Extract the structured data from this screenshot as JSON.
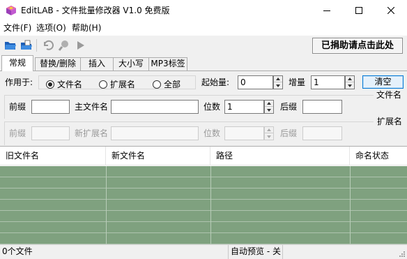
{
  "window": {
    "title": "EditLAB - 文件批量修改器 V1.0 免费版",
    "icon": "app-box-icon"
  },
  "menu": [
    {
      "label": "文件(F)"
    },
    {
      "label": "选项(O)"
    },
    {
      "label": "帮助(H)"
    }
  ],
  "toolbar": {
    "icons": [
      "open-folder-icon",
      "open-files-icon",
      "undo-icon",
      "search-icon",
      "play-icon"
    ],
    "donate_label": "已捐助请点击此处"
  },
  "tabs": [
    {
      "label": "常规",
      "active": true
    },
    {
      "label": "替换/删除"
    },
    {
      "label": "插入"
    },
    {
      "label": "大小写"
    },
    {
      "label": "MP3标签"
    }
  ],
  "general": {
    "apply_to_label": "作用于:",
    "options": [
      {
        "label": "文件名",
        "selected": true
      },
      {
        "label": "扩展名",
        "selected": false
      },
      {
        "label": "全部",
        "selected": false
      }
    ],
    "start_label": "起始量:",
    "start_value": "0",
    "step_label": "增量",
    "step_value": "1",
    "clear_label": "清空",
    "filename_group_label": "文件名",
    "prefix_label": "前缀",
    "prefix_value": "",
    "main_name_label": "主文件名",
    "main_name_value": "",
    "digits_label": "位数",
    "digits_value": "1",
    "suffix_label": "后缀",
    "suffix_value": "",
    "ext_group_label": "扩展名",
    "ext_prefix_label": "前缀",
    "new_ext_label": "新扩展名",
    "ext_digits_label": "位数",
    "ext_suffix_label": "后缀"
  },
  "table": {
    "columns": [
      "旧文件名",
      "新文件名",
      "路径",
      "命名状态"
    ],
    "row_color": "#7fa17f"
  },
  "status": {
    "file_count": "0个文件",
    "auto_preview": "自动预览 - 关"
  },
  "colors": {
    "accent": "#0078d7",
    "row_green": "#7fa17f"
  }
}
